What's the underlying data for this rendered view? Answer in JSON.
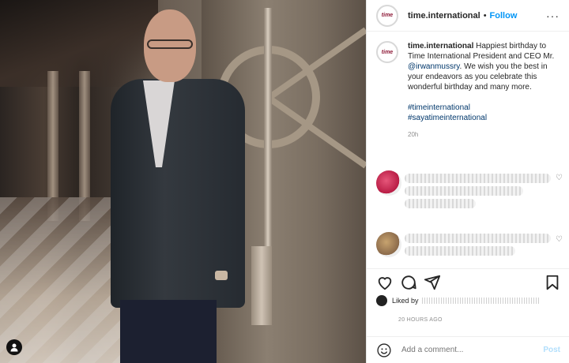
{
  "header": {
    "username": "time.international",
    "separator": "•",
    "follow_label": "Follow",
    "more_label": "···"
  },
  "caption": {
    "username": "time.international",
    "text_before": "Happiest birthday to Time International President and CEO Mr.",
    "mention": "@irwanmussry",
    "text_after": ". We wish you the best in your endeavors as you celebrate this wonderful birthday and many more.",
    "hashtag_1": "#timeinternational",
    "hashtag_2": "#sayatimeinternational",
    "time": "20h"
  },
  "avatar": {
    "label": "time"
  },
  "likes": {
    "prefix": "Liked by"
  },
  "timestamp": "20 HOURS AGO",
  "add_comment": {
    "placeholder": "Add a comment...",
    "post_label": "Post"
  },
  "colors": {
    "link": "#0095f6",
    "mention": "#00376b",
    "brand": "#8e1a38"
  }
}
